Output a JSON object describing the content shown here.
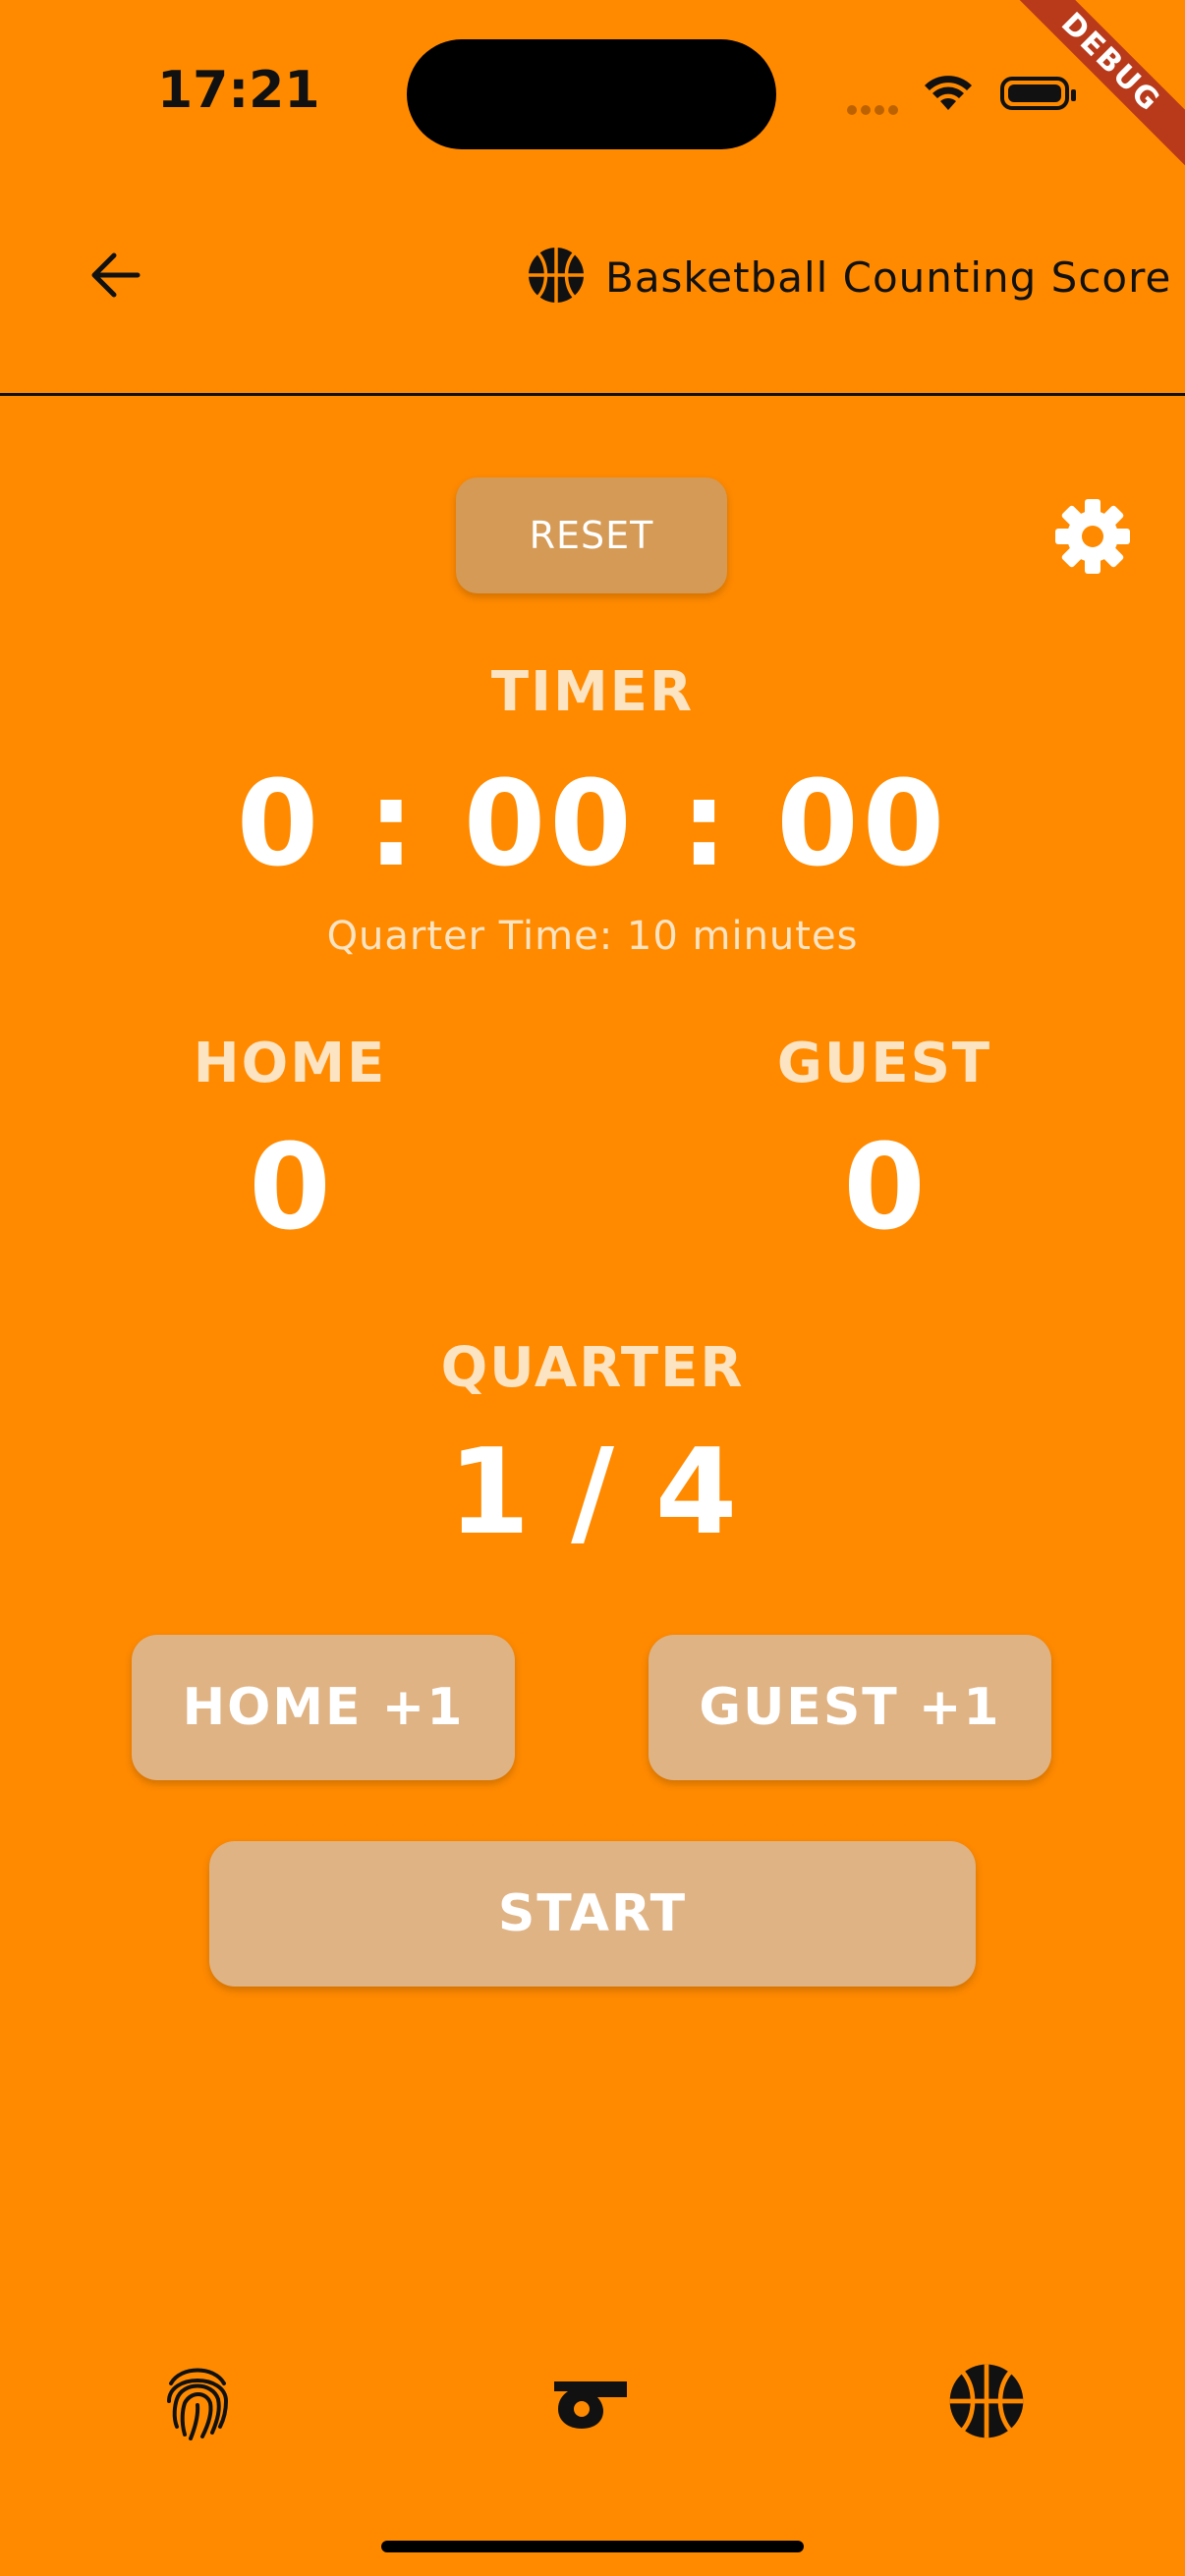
{
  "status_bar": {
    "time": "17:21",
    "debug_label": "DEBUG"
  },
  "app_bar": {
    "title": "Basketball Counting Score",
    "title_icon": "basketball-icon",
    "back_icon": "back-arrow-icon"
  },
  "controls": {
    "reset_label": "RESET",
    "settings_icon": "gear-icon"
  },
  "timer": {
    "label": "TIMER",
    "value": "0 : 00 : 00",
    "quarter_time": "Quarter Time: 10 minutes"
  },
  "scores": {
    "home": {
      "label": "HOME",
      "value": "0"
    },
    "guest": {
      "label": "GUEST",
      "value": "0"
    }
  },
  "quarter": {
    "label": "QUARTER",
    "value": "1 / 4"
  },
  "actions": {
    "home_plus": "HOME +1",
    "guest_plus": "GUEST +1",
    "start": "START"
  },
  "bottom_nav": {
    "items": [
      "fingerprint-icon",
      "whistle-icon",
      "basketball-icon"
    ]
  },
  "colors": {
    "background": "#FF8A00",
    "button": "#DFB384",
    "reset_button": "#D59A55",
    "label": "#FCE4C3"
  }
}
